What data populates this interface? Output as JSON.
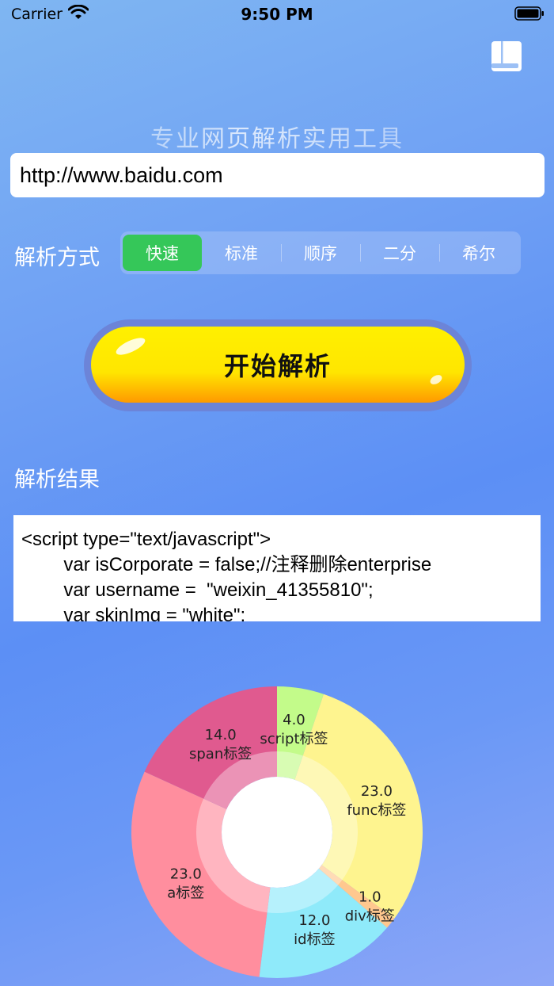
{
  "status_bar": {
    "carrier": "Carrier",
    "time": "9:50 PM"
  },
  "header": {
    "subtitle": "专业网页解析实用工具",
    "icons": [
      "wifi-icon",
      "battery-icon",
      "book-icon"
    ]
  },
  "url_input": {
    "value": "http://www.baidu.com"
  },
  "parse_mode": {
    "label": "解析方式",
    "options": [
      "快速",
      "标准",
      "顺序",
      "二分",
      "希尔"
    ],
    "selected": "快速"
  },
  "start_button": {
    "label": "开始解析"
  },
  "result": {
    "label": "解析结果",
    "lines": [
      "<script type=\"text/javascript\">",
      "        var isCorporate = false;//注释删除enterprise",
      "        var username =  \"weixin_41355810\";",
      "        var skinImg = \"white\";"
    ]
  },
  "colors": {
    "segment_active": "#35c759",
    "button_yellow": "#ffe600",
    "button_orange": "#ff9a00"
  },
  "chart_data": {
    "type": "pie",
    "style": "donut",
    "categories": [
      "script标签",
      "func标签",
      "div标签",
      "id标签",
      "a标签",
      "span标签"
    ],
    "values": [
      4.0,
      23.0,
      1.0,
      12.0,
      23.0,
      14.0
    ],
    "value_labels": [
      "4.0",
      "23.0",
      "1.0",
      "12.0",
      "23.0",
      "14.0"
    ],
    "colors": [
      "#c3fb8a",
      "#fef48f",
      "#ffc88f",
      "#8feafa",
      "#ff8e9e",
      "#e05a8f"
    ]
  }
}
